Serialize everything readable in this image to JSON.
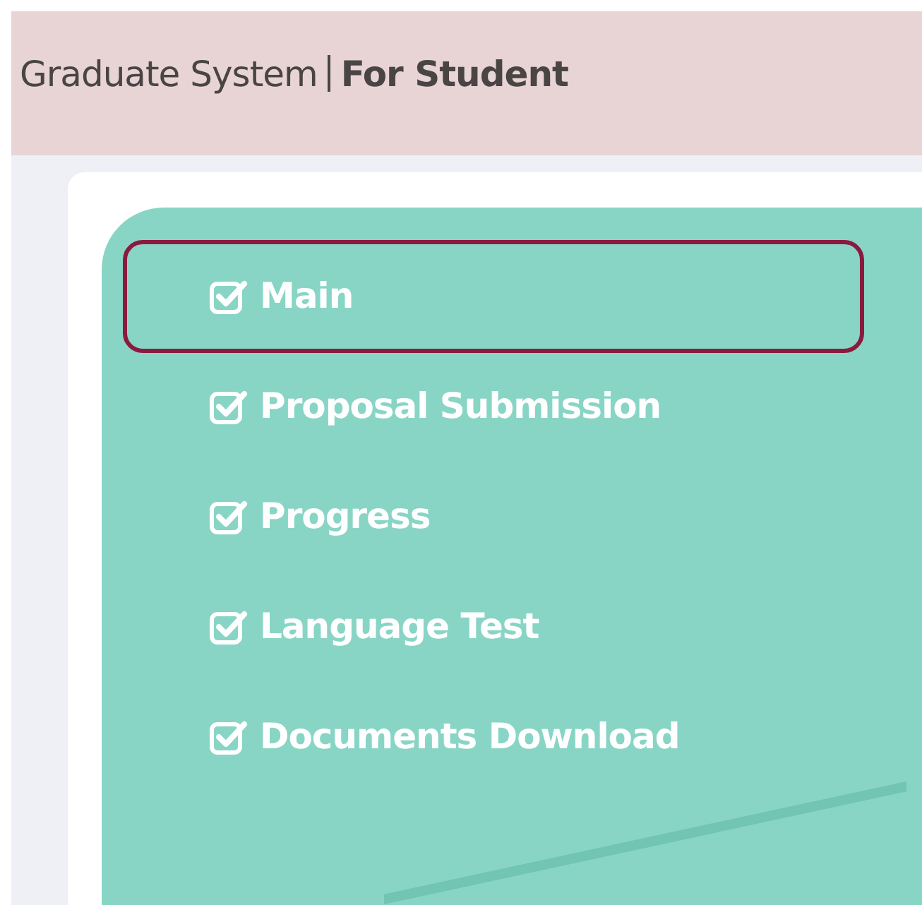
{
  "header": {
    "title": "Graduate System",
    "subtitle": "For Student"
  },
  "menu": [
    {
      "label": "Main",
      "selected": true
    },
    {
      "label": "Proposal Submission",
      "selected": false
    },
    {
      "label": "Progress",
      "selected": false
    },
    {
      "label": "Language Test",
      "selected": false
    },
    {
      "label": "Documents Download",
      "selected": false
    }
  ]
}
